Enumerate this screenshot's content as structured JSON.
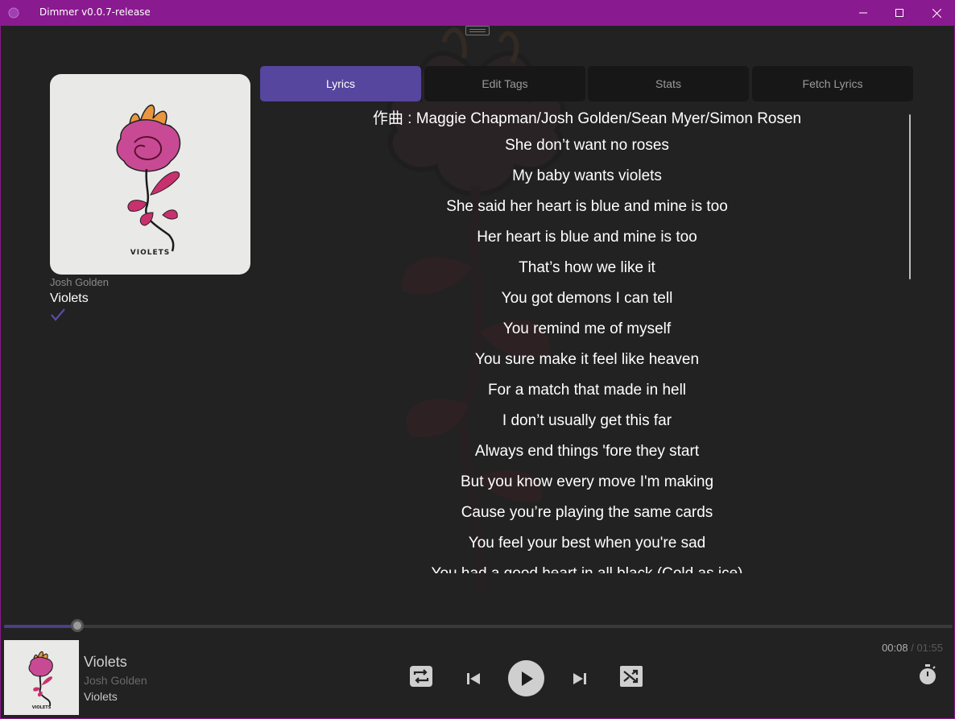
{
  "window": {
    "title": "Dimmer v0.0.7-release"
  },
  "album": {
    "art_label": "VIOLETS",
    "artist": "Josh Golden",
    "title": "Violets"
  },
  "tabs": [
    {
      "label": "Lyrics",
      "active": true
    },
    {
      "label": "Edit Tags",
      "active": false
    },
    {
      "label": "Stats",
      "active": false
    },
    {
      "label": "Fetch Lyrics",
      "active": false
    }
  ],
  "lyrics": [
    "作曲 : Maggie Chapman/Josh Golden/Sean Myer/Simon Rosen",
    "She don’t want no roses",
    "My baby wants violets",
    "She said her heart is blue and mine is too",
    "Her heart is blue and mine is too",
    "That’s how we like it",
    "You got demons I can tell",
    "You remind me of myself",
    "You sure make it feel like heaven",
    "For a match that made in hell",
    "I don’t usually get this far",
    "Always end things 'fore they start",
    "But you know every move I'm making",
    "Cause you’re playing the same cards",
    "You feel your best when you're sad",
    "You had a good heart in all black (Cold as ice)"
  ],
  "player": {
    "title": "Violets",
    "artist": "Josh Golden",
    "album": "Violets",
    "time_current": "00:08",
    "time_separator": " / ",
    "time_total": "01:55",
    "progress": 0.077,
    "mini_art_label": "VIOLETS"
  },
  "colors": {
    "accent": "#56469e",
    "titlebar": "#8a1a8f"
  },
  "icons": {
    "minimize": "minimize-icon",
    "maximize": "maximize-icon",
    "close": "close-icon",
    "check": "check-icon",
    "repeat": "repeat-icon",
    "previous": "skip-previous-icon",
    "play": "play-icon",
    "next": "skip-next-icon",
    "shuffle": "shuffle-icon",
    "timer": "timer-icon"
  }
}
